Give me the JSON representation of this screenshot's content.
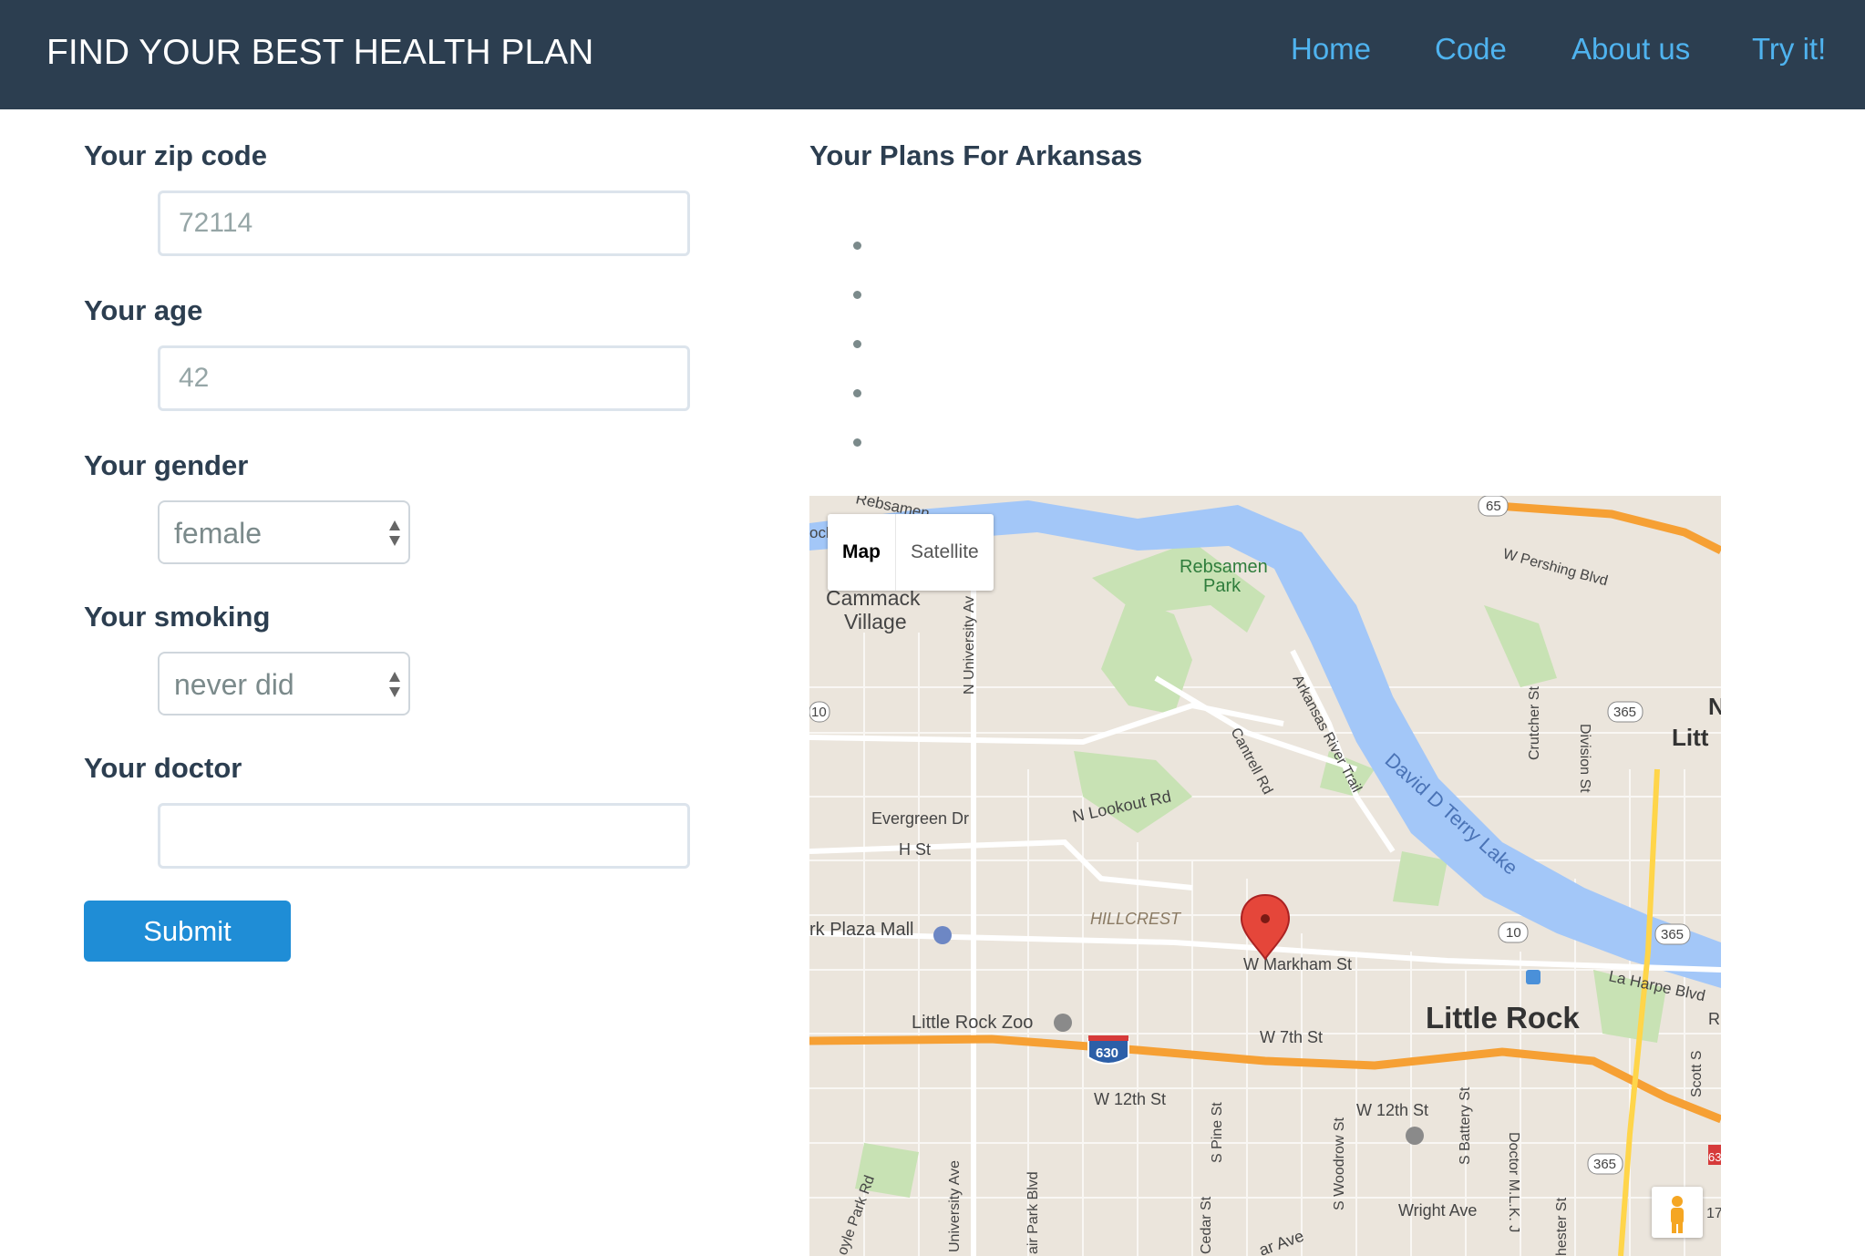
{
  "header": {
    "brand": "FIND YOUR BEST HEALTH PLAN",
    "nav": [
      {
        "label": "Home"
      },
      {
        "label": "Code"
      },
      {
        "label": "About us"
      },
      {
        "label": "Try it!"
      }
    ]
  },
  "form": {
    "zip": {
      "label": "Your zip code",
      "placeholder": "72114"
    },
    "age": {
      "label": "Your age",
      "placeholder": "42"
    },
    "gender": {
      "label": "Your gender",
      "value": "female"
    },
    "smoking": {
      "label": "Your smoking",
      "value": "never did"
    },
    "doctor": {
      "label": "Your doctor",
      "value": ""
    },
    "submit_label": "Submit"
  },
  "plans": {
    "title": "Your Plans For Arkansas",
    "items": [
      "",
      "",
      "",
      "",
      ""
    ]
  },
  "map": {
    "type_controls": {
      "map": "Map",
      "satellite": "Satellite"
    },
    "labels": {
      "rebsamen": "Rebsamen",
      "park": "Park",
      "cammack": "Cammack",
      "village": "Village",
      "pershing": "W Pershing Blvd",
      "n_university": "N University Av",
      "arkansas_river_trail": "Arkansas River Trail",
      "cantrell": "Cantrell Rd",
      "david_terry_lake": "David D Terry Lake",
      "crutcher": "Crutcher St",
      "division": "Division St",
      "evergreen": "Evergreen Dr",
      "lookout": "N Lookout Rd",
      "h_st": "H St",
      "hillcrest": "HILLCREST",
      "park_plaza": "rk Plaza Mall",
      "markham": "W Markham St",
      "la_harpe": "La Harpe Blvd",
      "little_rock": "Little Rock",
      "zoo": "Little Rock Zoo",
      "w7th": "W 7th St",
      "w12th_a": "W 12th St",
      "w12th_b": "W 12th St",
      "pine": "S Pine St",
      "woodrow": "S Woodrow St",
      "battery": "S Battery St",
      "mlk": "Doctor M.L.K. J",
      "univ_ave": "University Ave",
      "fair_park": "air Park Blvd",
      "cedar": "Cedar St",
      "wright": "Wright Ave",
      "boyle": "oyle Park Rd",
      "hwy_630": "630",
      "hwy_65": "65",
      "hwy_10a": "10",
      "hwy_10b": "10",
      "hwy_365a": "365",
      "hwy_365b": "365",
      "hwy_365c": "365",
      "scott": "Scott S",
      "n_litt": "N",
      "litt": "Litt",
      "chester": "hester St",
      "r_edge": "R",
      "ar_ave": "ar Ave",
      "hwy_63": "63",
      "hwy_17": "17",
      "rebsamen_edge": "Rebsamen",
      "ock_edge": "ock"
    }
  },
  "colors": {
    "navbar": "#2c3e50",
    "nav_link": "#4fb3ef",
    "primary_button": "#1f8dd6",
    "water": "#a3c7f8",
    "park": "#c8e2b4",
    "highway": "#f6a034",
    "marker": "#e5463a"
  }
}
